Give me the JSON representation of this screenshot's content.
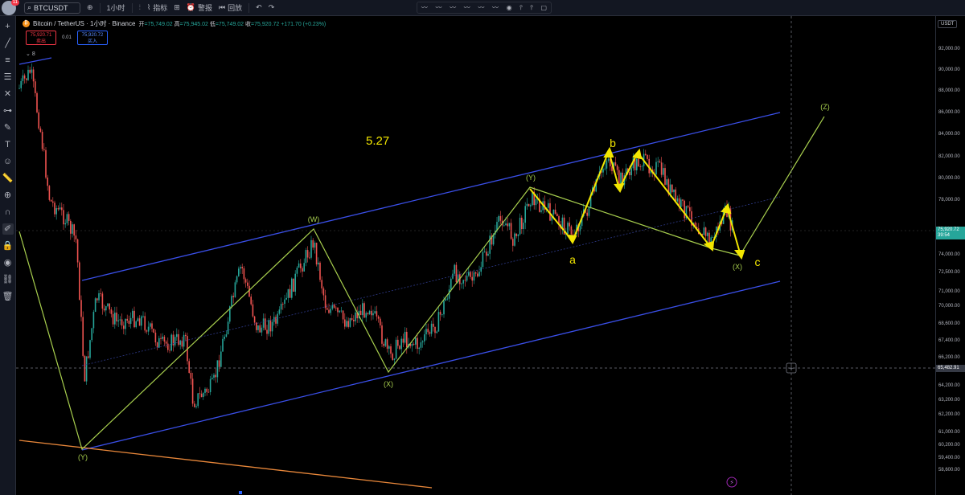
{
  "topbar": {
    "user_badge": "11",
    "symbol": "BTCUSDT",
    "interval": "1小时",
    "indicators_label": "指标",
    "alert_label": "警报",
    "replay_label": "回放"
  },
  "legend": {
    "title": "Bitcoin / TetherUS · 1小时 · Binance",
    "open_key": "开",
    "open_val": "=75,749.02",
    "high_key": "高",
    "high_val": "=75,945.02",
    "low_key": "低",
    "low_val": "=75,749.02",
    "close_key": "收",
    "close_val": "=75,920.72",
    "change": "+171.70 (+0.23%)"
  },
  "trade": {
    "sell_price": "75,920.71",
    "sell_label": "卖出",
    "spread": "0.01",
    "buy_price": "75,920.72",
    "buy_label": "买入"
  },
  "indicator_count": "8",
  "annotations": {
    "date_label": "5.27",
    "w": "(W)",
    "x1": "(X)",
    "y_low": "(Y)",
    "y_high": "(Y)",
    "x2": "(X)",
    "z": "(Z)",
    "a": "a",
    "b": "b",
    "c": "c"
  },
  "axis": {
    "currency": "USDT",
    "ticks": [
      "92,000.00",
      "90,000.00",
      "88,000.00",
      "86,000.00",
      "84,000.00",
      "82,000.00",
      "80,000.00",
      "78,000.00",
      "74,000.00",
      "72,500.00",
      "71,000.00",
      "70,000.00",
      "68,600.00",
      "67,400.00",
      "66,200.00",
      "64,200.00",
      "63,200.00",
      "62,200.00",
      "61,000.00",
      "60,200.00",
      "59,400.00",
      "58,600.00"
    ],
    "current_price": "75,920.72",
    "countdown": "39:54",
    "crosshair_price": "65,482.91"
  },
  "colors": {
    "channel": "#3a4fe8",
    "wave": "#a8cf4e",
    "sub_wave": "#f2e600",
    "trend": "#e8873a",
    "up": "#26a69a",
    "down": "#ef5350"
  }
}
